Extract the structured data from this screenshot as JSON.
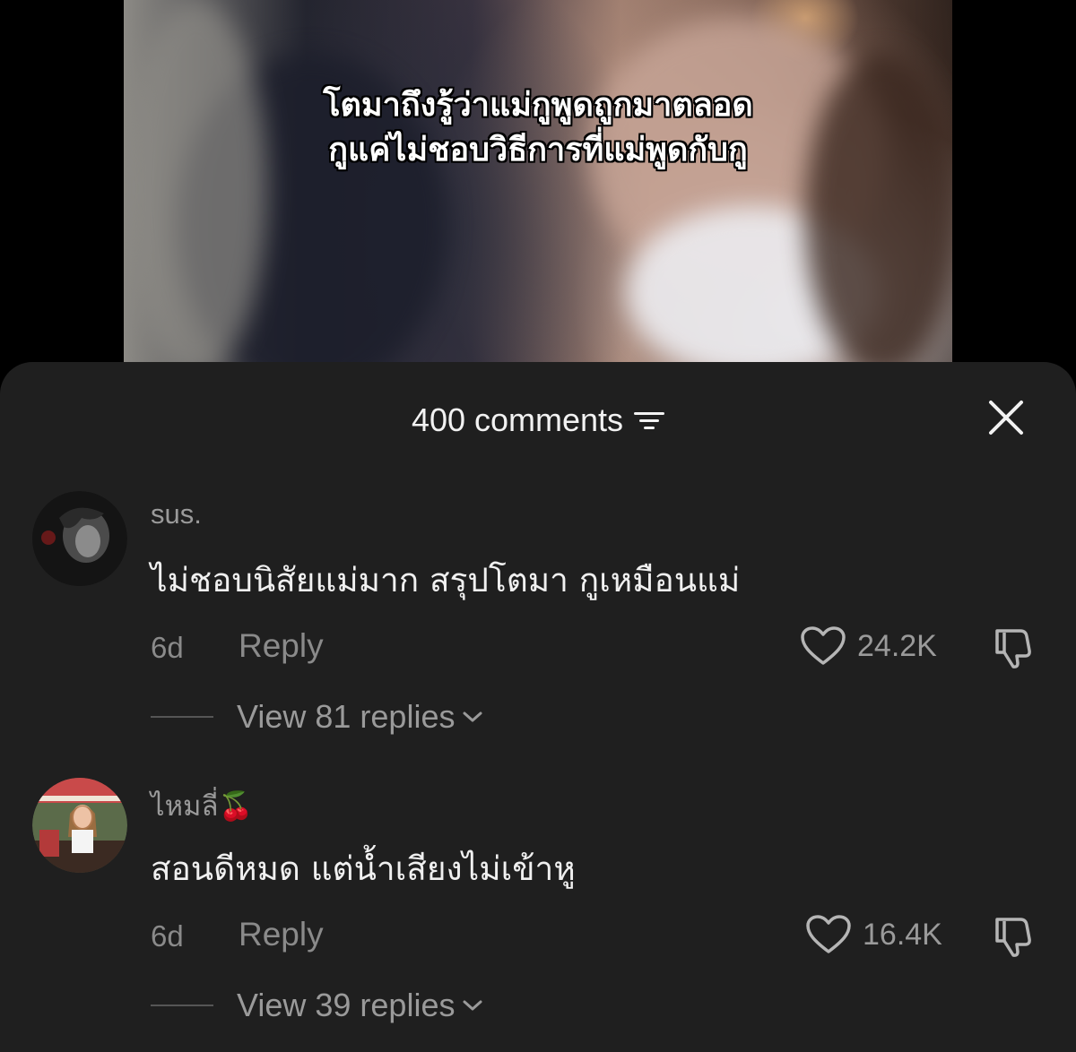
{
  "video": {
    "subtitle_line1": "โตมาถึงรู้ว่าแม่กูพูดถูกมาตลอด",
    "subtitle_line2": "กูแค่ไม่ชอบวิธีการที่แม่พูดกับกู"
  },
  "comments_panel": {
    "title": "400 comments",
    "sort_icon": "sort-lines-icon",
    "close_icon": "close-icon"
  },
  "comments": [
    {
      "username": "sus.",
      "text": "ไม่ชอบนิสัยแม่มาก สรุปโตมา กูเหมือนแม่",
      "age": "6d",
      "reply_label": "Reply",
      "likes": "24.2K",
      "view_replies": "View 81 replies"
    },
    {
      "username": "ไหมลี่🍒",
      "text": "สอนดีหมด แต่น้ำเสียงไม่เข้าหู",
      "age": "6d",
      "reply_label": "Reply",
      "likes": "16.4K",
      "view_replies": "View 39 replies"
    }
  ],
  "colors": {
    "sheet_bg": "#1f1f1f",
    "muted_text": "#8a8a8a",
    "primary_text": "#f0f0f0"
  }
}
